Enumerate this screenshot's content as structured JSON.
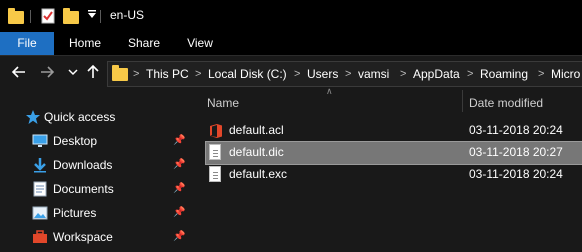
{
  "window": {
    "title": "en-US"
  },
  "ribbon": {
    "tabs": [
      {
        "label": "File",
        "active": true
      },
      {
        "label": "Home"
      },
      {
        "label": "Share"
      },
      {
        "label": "View"
      }
    ]
  },
  "address": {
    "crumbs": [
      "This PC",
      "Local Disk (C:)",
      "Users",
      "vamsi",
      "AppData",
      "Roaming",
      "Micro"
    ]
  },
  "sidebar": {
    "items": [
      {
        "label": "Quick access",
        "icon": "star-icon"
      },
      {
        "label": "Desktop",
        "icon": "desktop-icon",
        "pinned": true
      },
      {
        "label": "Downloads",
        "icon": "download-icon",
        "pinned": true
      },
      {
        "label": "Documents",
        "icon": "documents-icon",
        "pinned": true
      },
      {
        "label": "Pictures",
        "icon": "pictures-icon",
        "pinned": true
      },
      {
        "label": "Workspace",
        "icon": "briefcase-icon",
        "pinned": true
      }
    ]
  },
  "list": {
    "columns": {
      "name": "Name",
      "date": "Date modified"
    },
    "files": [
      {
        "name": "default.acl",
        "date": "03-11-2018 20:24",
        "icon": "office-icon"
      },
      {
        "name": "default.dic",
        "date": "03-11-2018 20:27",
        "icon": "file-icon",
        "selected": true
      },
      {
        "name": "default.exc",
        "date": "03-11-2018 20:24",
        "icon": "file-icon"
      }
    ]
  },
  "colors": {
    "file_tab": "#1e6fc2",
    "folder": "#f7c948",
    "selection": "#777777",
    "office": "#e2472a"
  }
}
